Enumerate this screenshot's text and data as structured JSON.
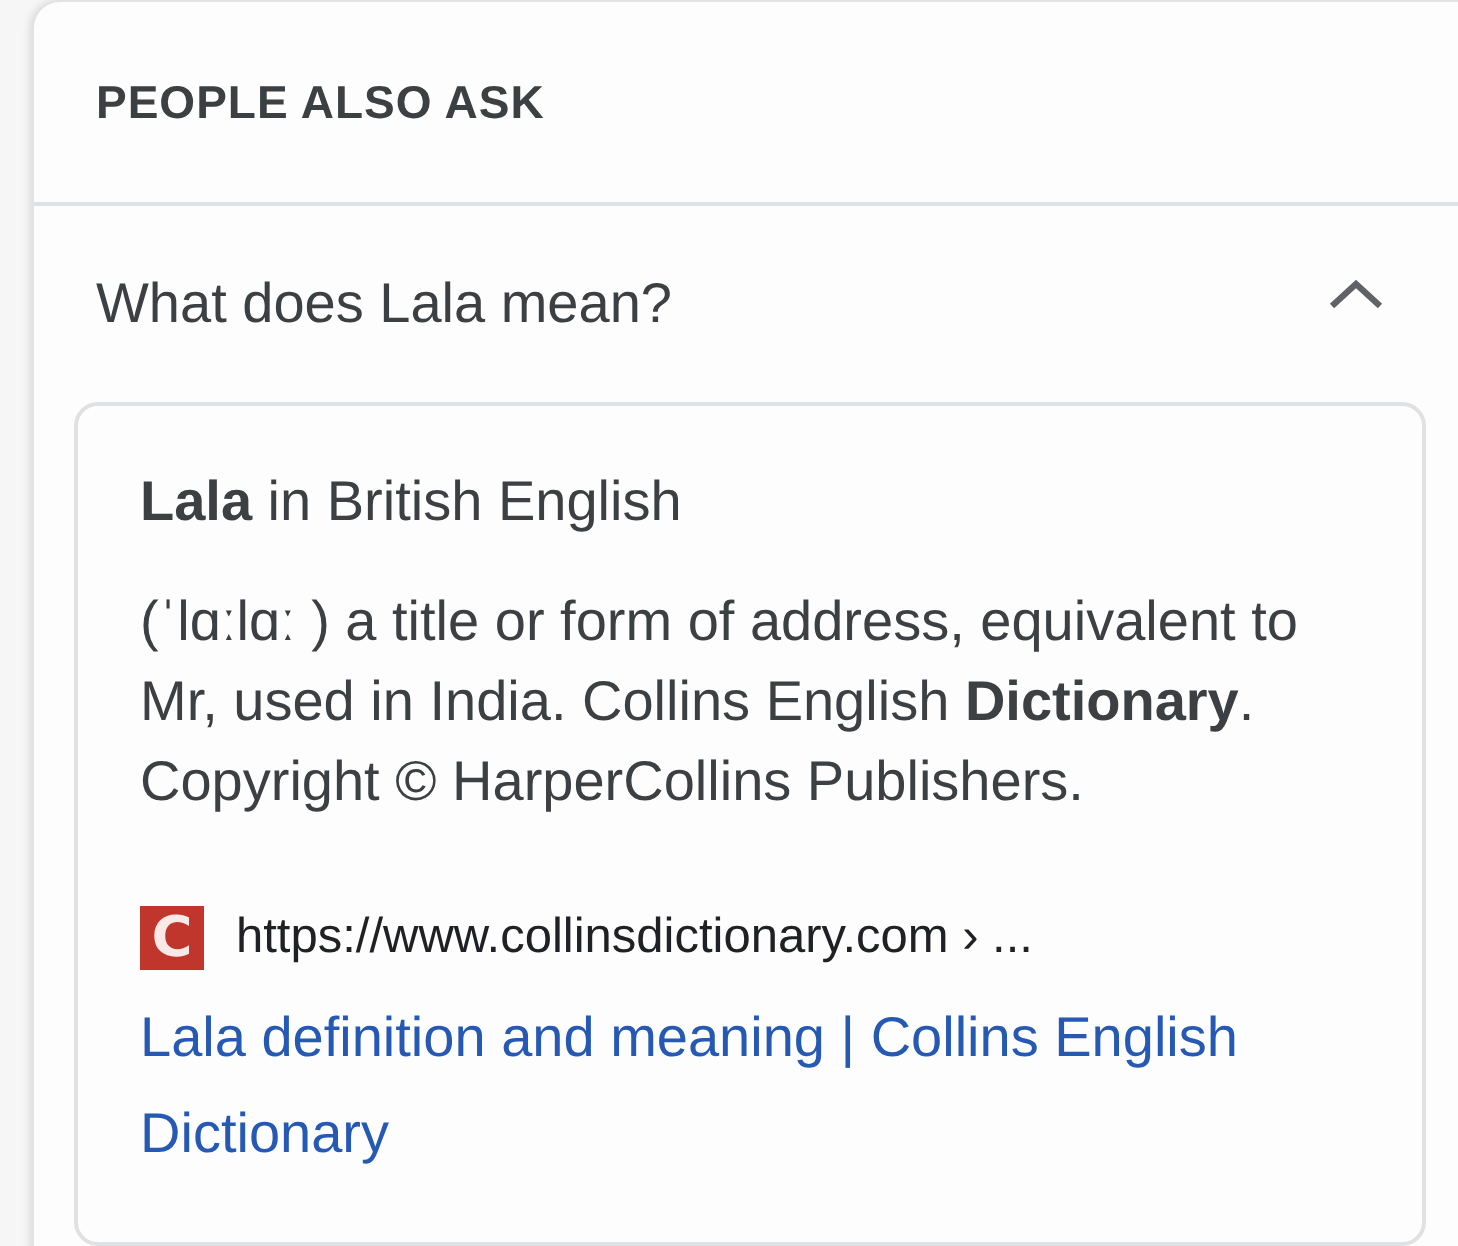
{
  "section": {
    "title": "PEOPLE ALSO ASK"
  },
  "questions": [
    {
      "question": "What does Lala mean?",
      "expanded": true,
      "answer": {
        "heading": "**Lala** in British English",
        "definition": "(ˈlɑːlɑː ) a title or form of address, equivalent to Mr, used in India. Collins English **Dictionary**. Copyright © HarperCollins Publishers.",
        "favicon_letter": "C",
        "source_url": "https://www.collinsdictionary.com › ...",
        "link": "Lala definition and meaning | Collins English Dictionary"
      }
    }
  ]
}
